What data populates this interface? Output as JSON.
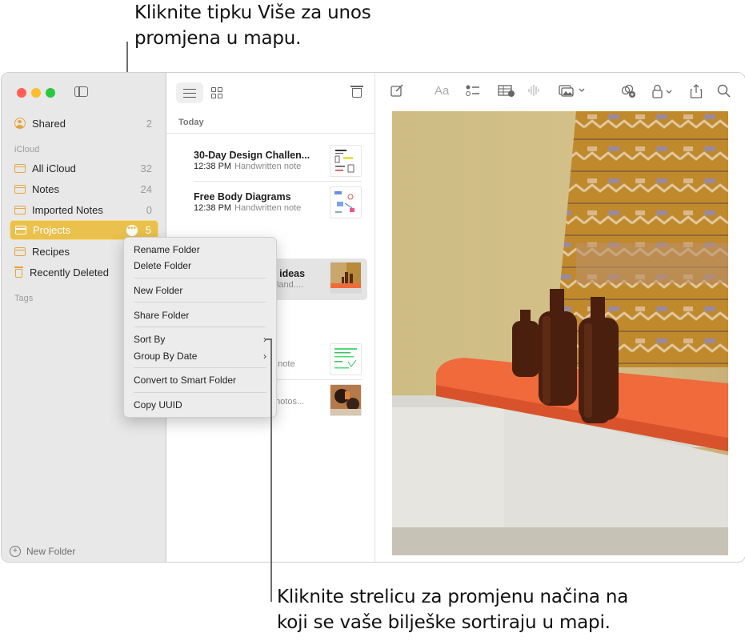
{
  "callouts": {
    "top": [
      "Kliknite tipku Više za unos",
      "promjena u mapu."
    ],
    "bottom": [
      "Kliknite strelicu za promjenu načina na",
      "koji se vaše bilješke sortiraju u mapi."
    ]
  },
  "sidebar": {
    "shared": {
      "label": "Shared",
      "count": "2",
      "icon": "person-circle-icon"
    },
    "section_icloud": "iCloud",
    "folders": [
      {
        "label": "All iCloud",
        "count": "32",
        "icon": "folder-icon"
      },
      {
        "label": "Notes",
        "count": "24",
        "icon": "folder-icon"
      },
      {
        "label": "Imported Notes",
        "count": "0",
        "icon": "folder-icon"
      },
      {
        "label": "Projects",
        "count": "5",
        "icon": "folder-icon",
        "selected": true,
        "more_button": "•••"
      },
      {
        "label": "Recipes",
        "count": "",
        "icon": "folder-icon"
      },
      {
        "label": "Recently Deleted",
        "count": "",
        "icon": "trash-icon"
      }
    ],
    "section_tags": "Tags",
    "new_folder_label": "New Folder",
    "new_folder_icon": "+"
  },
  "note_list": {
    "section_label": "Today",
    "notes": [
      {
        "title": "30-Day Design Challen...",
        "time": "12:38 PM",
        "kind": "Handwritten note"
      },
      {
        "title": "Free Body Diagrams",
        "time": "12:38 PM",
        "kind": "Handwritten note"
      },
      {
        "title": "g ideas",
        "time": "",
        "kind": "island...."
      },
      {
        "title": "",
        "time": "",
        "kind": "n note"
      },
      {
        "title": "",
        "time": "",
        "kind": "photos..."
      }
    ]
  },
  "context_menu": {
    "items": [
      {
        "label": "Rename Folder"
      },
      {
        "label": "Delete Folder"
      },
      {
        "label": "New Folder"
      },
      {
        "label": "Share Folder"
      },
      {
        "label": "Sort By",
        "submenu": "›"
      },
      {
        "label": "Group By Date",
        "submenu": "›"
      },
      {
        "label": "Convert to Smart Folder"
      },
      {
        "label": "Copy UUID"
      }
    ]
  },
  "toolbar": {
    "format_label": "Aa",
    "icons": [
      "compose-icon",
      "format-icon",
      "checklist-icon",
      "table-icon",
      "audio-icon",
      "media-icon",
      "collaborate-icon",
      "lock-icon",
      "share-icon",
      "search-icon"
    ]
  },
  "colors": {
    "accent": "#e9c14c",
    "folder_icon": "#e5a63a",
    "shelf": "#f06a3c"
  }
}
